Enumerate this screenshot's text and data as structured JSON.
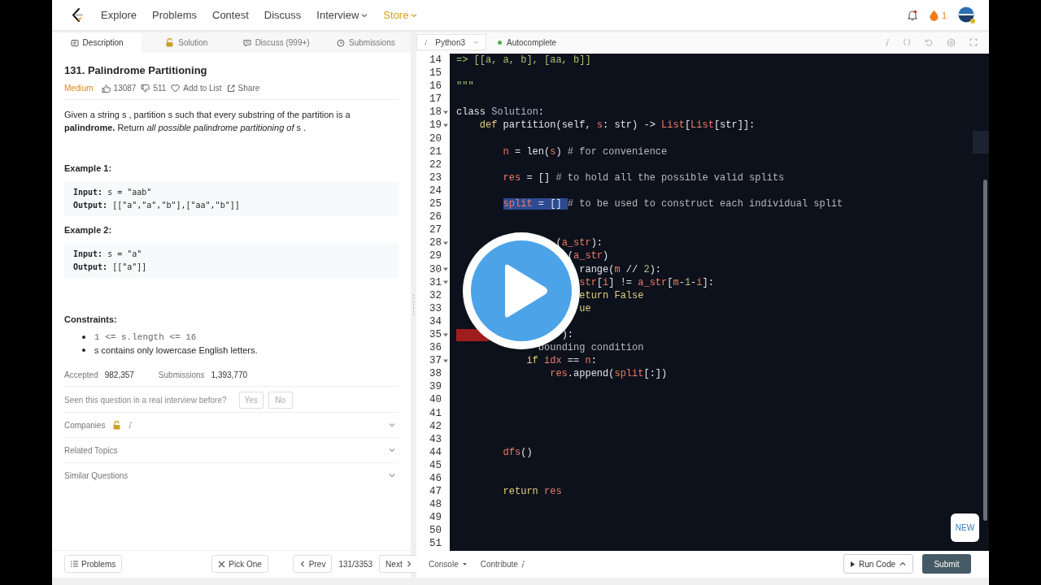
{
  "nav": {
    "links": [
      {
        "label": "Explore",
        "kind": "link"
      },
      {
        "label": "Problems",
        "kind": "link"
      },
      {
        "label": "Contest",
        "kind": "link"
      },
      {
        "label": "Discuss",
        "kind": "link"
      },
      {
        "label": "Interview",
        "kind": "menu"
      },
      {
        "label": "Store",
        "kind": "store"
      }
    ],
    "streak": "1"
  },
  "tabs": [
    {
      "label": "Description",
      "kind": "doc",
      "selected": true
    },
    {
      "label": "Solution",
      "kind": "lock",
      "selected": false
    },
    {
      "label": "Discuss (999+)",
      "kind": "chat",
      "selected": false
    },
    {
      "label": "Submissions",
      "kind": "clock",
      "selected": false
    }
  ],
  "problem": {
    "title": "131. Palindrome Partitioning",
    "difficulty": "Medium",
    "likes": "13087",
    "dislikes": "511",
    "actions": [
      {
        "label": "Add to List",
        "kind": "heart"
      },
      {
        "label": "Share",
        "kind": "share"
      }
    ],
    "statement": "Given a string  s , partition  s  such that every substring of the partition is a **palindrome.** Return *all possible palindrome partitioning of*  s .",
    "examples": [
      {
        "title": "Example 1:",
        "lines": [
          "**Input:** s = \"aab\"",
          "**Output:** [[\"a\",\"a\",\"b\"],[\"aa\",\"b\"]]"
        ]
      },
      {
        "title": "Example 2:",
        "lines": [
          "**Input:** s = \"a\"",
          "**Output:** [[\"a\"]]"
        ]
      }
    ],
    "constraints_title": "Constraints:",
    "constraints": [
      {
        "text": "1 <= s.length <= 16",
        "kind": "code"
      },
      {
        "text": "s  contains only lowercase English letters.",
        "kind": "text"
      }
    ],
    "stats": [
      {
        "label": "Accepted",
        "value": "982,357"
      },
      {
        "label": "Submissions",
        "value": "1,393,770"
      }
    ],
    "interview": {
      "question": "Seen this question in a real interview before?",
      "buttons": [
        "Yes",
        "No"
      ]
    },
    "sections": [
      {
        "label": "Companies",
        "locked": true
      },
      {
        "label": "Related Topics",
        "locked": false
      },
      {
        "label": "Similar Questions",
        "locked": false
      }
    ]
  },
  "footer": {
    "problems": "Problems",
    "pick": "Pick One",
    "prev": "Prev",
    "position": "131/3353",
    "next": "Next"
  },
  "editor": {
    "language": "Python3",
    "autocomplete": {
      "label": "Autocomplete",
      "on": true
    },
    "lines": [
      {
        "n": "14",
        "fold": false,
        "marked": false,
        "tokens": [
          {
            "text": "=> [[a, a, b], [aa, b]]",
            "kind": "str"
          }
        ]
      },
      {
        "n": "15",
        "fold": false,
        "marked": false
      },
      {
        "n": "16",
        "fold": false,
        "marked": false,
        "tokens": [
          {
            "text": "\"\"\"",
            "kind": "str"
          }
        ]
      },
      {
        "n": "17",
        "fold": false,
        "marked": false
      },
      {
        "n": "18",
        "fold": true,
        "marked": false,
        "tokens": [
          {
            "text": "class ",
            "kind": "plain"
          },
          {
            "text": "Solution",
            "kind": "cls"
          },
          {
            "text": ":",
            "kind": "plain"
          }
        ]
      },
      {
        "n": "19",
        "fold": true,
        "marked": false,
        "tokens": [
          {
            "text": "    def",
            "kind": "kw"
          },
          {
            "text": " partition(self, ",
            "kind": "plain"
          },
          {
            "text": "s",
            "kind": "var"
          },
          {
            "text": ": str) -> ",
            "kind": "plain"
          },
          {
            "text": "List",
            "kind": "var"
          },
          {
            "text": "[",
            "kind": "plain"
          },
          {
            "text": "List",
            "kind": "var"
          },
          {
            "text": "[str]]:",
            "kind": "plain"
          }
        ]
      },
      {
        "n": "20",
        "fold": false,
        "marked": false
      },
      {
        "n": "21",
        "fold": false,
        "marked": false,
        "tokens": [
          {
            "text": "        n",
            "kind": "var"
          },
          {
            "text": " = len(",
            "kind": "plain"
          },
          {
            "text": "s",
            "kind": "var"
          },
          {
            "text": ") ",
            "kind": "plain"
          },
          {
            "text": "# for convenience",
            "kind": "com"
          }
        ]
      },
      {
        "n": "22",
        "fold": false,
        "marked": false
      },
      {
        "n": "23",
        "fold": false,
        "marked": false,
        "tokens": [
          {
            "text": "        res",
            "kind": "var"
          },
          {
            "text": " = [] ",
            "kind": "plain"
          },
          {
            "text": "# to hold all the possible valid splits",
            "kind": "com"
          }
        ]
      },
      {
        "n": "24",
        "fold": false,
        "marked": false
      },
      {
        "n": "25",
        "fold": false,
        "marked": false,
        "tokens": [
          {
            "text": "        split",
            "kind": "var",
            "selected": true
          },
          {
            "text": " = [] ",
            "kind": "plain",
            "selected": true
          },
          {
            "text": "# to be used to construct each individual split",
            "kind": "com",
            "selected": false
          }
        ]
      },
      {
        "n": "26",
        "fold": false,
        "marked": false
      },
      {
        "n": "27",
        "fold": false,
        "marked": false
      },
      {
        "n": "28",
        "fold": true,
        "marked": false,
        "tokens": [
          {
            "text": "                 (",
            "kind": "plain"
          },
          {
            "text": "a_str",
            "kind": "var"
          },
          {
            "text": "):",
            "kind": "plain"
          }
        ]
      },
      {
        "n": "29",
        "fold": false,
        "marked": false,
        "tokens": [
          {
            "text": "                   (",
            "kind": "plain"
          },
          {
            "text": "a_str",
            "kind": "var"
          },
          {
            "text": ")",
            "kind": "plain"
          }
        ]
      },
      {
        "n": "30",
        "fold": true,
        "marked": false,
        "tokens": [
          {
            "text": "                     range(",
            "kind": "plain"
          },
          {
            "text": "m",
            "kind": "var"
          },
          {
            "text": " // ",
            "kind": "plain"
          },
          {
            "text": "2",
            "kind": "num"
          },
          {
            "text": "):",
            "kind": "plain"
          }
        ]
      },
      {
        "n": "31",
        "fold": true,
        "marked": false,
        "tokens": [
          {
            "text": "                     str",
            "kind": "var"
          },
          {
            "text": "[",
            "kind": "plain"
          },
          {
            "text": "i",
            "kind": "var"
          },
          {
            "text": "] != ",
            "kind": "plain"
          },
          {
            "text": "a_str",
            "kind": "var"
          },
          {
            "text": "[",
            "kind": "plain"
          },
          {
            "text": "m",
            "kind": "var"
          },
          {
            "text": "-",
            "kind": "plain"
          },
          {
            "text": "1",
            "kind": "num"
          },
          {
            "text": "-",
            "kind": "plain"
          },
          {
            "text": "i",
            "kind": "var"
          },
          {
            "text": "]:",
            "kind": "plain"
          }
        ]
      },
      {
        "n": "32",
        "fold": false,
        "marked": false,
        "tokens": [
          {
            "text": "                     eturn False",
            "kind": "kw"
          }
        ]
      },
      {
        "n": "33",
        "fold": false,
        "marked": false,
        "tokens": [
          {
            "text": "                     ue",
            "kind": "kw"
          }
        ]
      },
      {
        "n": "34",
        "fold": false,
        "marked": false
      },
      {
        "n": "35",
        "fold": true,
        "marked": true,
        "tokens": [
          {
            "text": "                  ):",
            "kind": "plain"
          }
        ]
      },
      {
        "n": "36",
        "fold": false,
        "marked": false,
        "tokens": [
          {
            "text": "              bounding condition",
            "kind": "com"
          }
        ]
      },
      {
        "n": "37",
        "fold": true,
        "marked": false,
        "tokens": [
          {
            "text": "            if",
            "kind": "kw"
          },
          {
            "text": " idx",
            "kind": "var"
          },
          {
            "text": " == ",
            "kind": "plain"
          },
          {
            "text": "n",
            "kind": "var"
          },
          {
            "text": ":",
            "kind": "plain"
          }
        ]
      },
      {
        "n": "38",
        "fold": false,
        "marked": false,
        "tokens": [
          {
            "text": "                res",
            "kind": "var"
          },
          {
            "text": ".append(",
            "kind": "plain"
          },
          {
            "text": "split",
            "kind": "var"
          },
          {
            "text": "[:])",
            "kind": "plain"
          }
        ]
      },
      {
        "n": "39",
        "fold": false,
        "marked": false
      },
      {
        "n": "40",
        "fold": false,
        "marked": false
      },
      {
        "n": "41",
        "fold": false,
        "marked": false
      },
      {
        "n": "42",
        "fold": false,
        "marked": false
      },
      {
        "n": "43",
        "fold": false,
        "marked": false
      },
      {
        "n": "44",
        "fold": false,
        "marked": false,
        "tokens": [
          {
            "text": "        dfs",
            "kind": "var"
          },
          {
            "text": "()",
            "kind": "plain"
          }
        ]
      },
      {
        "n": "45",
        "fold": false,
        "marked": false
      },
      {
        "n": "46",
        "fold": false,
        "marked": false
      },
      {
        "n": "47",
        "fold": false,
        "marked": false,
        "tokens": [
          {
            "text": "        return",
            "kind": "kw"
          },
          {
            "text": " res",
            "kind": "var"
          }
        ]
      },
      {
        "n": "48",
        "fold": false,
        "marked": false
      },
      {
        "n": "49",
        "fold": false,
        "marked": false
      },
      {
        "n": "50",
        "fold": false,
        "marked": false
      },
      {
        "n": "51",
        "fold": false,
        "marked": false
      }
    ],
    "new_badge": "NEW",
    "console": "Console",
    "contribute": "Contribute",
    "run": "Run Code",
    "submit": "Submit"
  }
}
